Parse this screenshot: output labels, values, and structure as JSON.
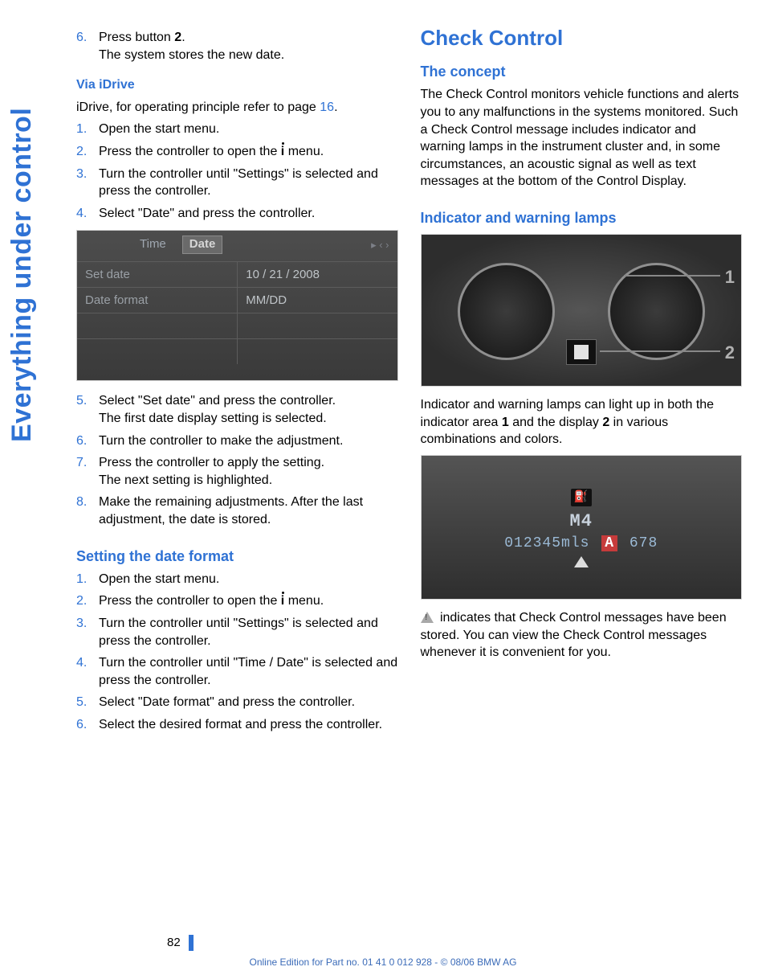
{
  "sideTab": "Everything under control",
  "left": {
    "step6": {
      "line1_a": "Press button ",
      "line1_b": "2",
      "line1_c": ".",
      "line2": "The system stores the new date."
    },
    "viaIDrive": {
      "heading": "Via iDrive",
      "intro_a": "iDrive, for operating principle refer to page ",
      "intro_link": "16",
      "intro_b": ".",
      "s1": "Open the start menu.",
      "s2_a": "Press the controller to open the ",
      "s2_b": " menu.",
      "s3": "Turn the controller until \"Settings\" is selected and press the controller.",
      "s4": "Select \"Date\" and press the controller."
    },
    "screenshot": {
      "tabTime": "Time",
      "tabDate": "Date",
      "rows": {
        "r1l": "Set date",
        "r1r": "10 / 21 / 2008",
        "r2l": "Date format",
        "r2r": "MM/DD"
      }
    },
    "steps5to8": {
      "s5a": "Select \"Set date\" and press the controller.",
      "s5b": "The first date display setting is selected.",
      "s6": "Turn the controller to make the adjustment.",
      "s7a": "Press the controller to apply the setting.",
      "s7b": "The next setting is highlighted.",
      "s8a": "Make the remaining adjustments. After the last adjustment, the date is stored."
    },
    "dateFormat": {
      "heading": "Setting the date format",
      "s1": "Open the start menu.",
      "s2_a": "Press the controller to open the ",
      "s2_b": " menu.",
      "s3": "Turn the controller until \"Settings\" is selected and press the controller.",
      "s4": "Turn the controller until \"Time / Date\" is selected and press the controller.",
      "s5": "Select \"Date format\" and press the controller.",
      "s6": "Select the desired format and press the controller."
    }
  },
  "right": {
    "h1": "Check Control",
    "concept": {
      "heading": "The concept",
      "body": "The Check Control monitors vehicle functions and alerts you to any malfunctions in the systems monitored. Such a Check Control message includes indicator and warning lamps in the instrument cluster and, in some circumstances, an acoustic signal as well as text messages at the bottom of the Control Display."
    },
    "lamps": {
      "heading": "Indicator and warning lamps",
      "caption_a": "Indicator and warning lamps can light up in both the indicator area ",
      "caption_b1": "1",
      "caption_c": " and the display ",
      "caption_b2": "2",
      "caption_d": " in various combinations and colors."
    },
    "odo": {
      "top": "M4",
      "bottom_a": "012345mls ",
      "warn": "A",
      "bottom_b": " 678"
    },
    "storedMsg": " indicates that Check Control messages have been stored. You can view the Check Control messages whenever it is convenient for you."
  },
  "pageNumber": "82",
  "footer": "Online Edition for Part no. 01 41 0 012 928 - © 08/06 BMW AG"
}
